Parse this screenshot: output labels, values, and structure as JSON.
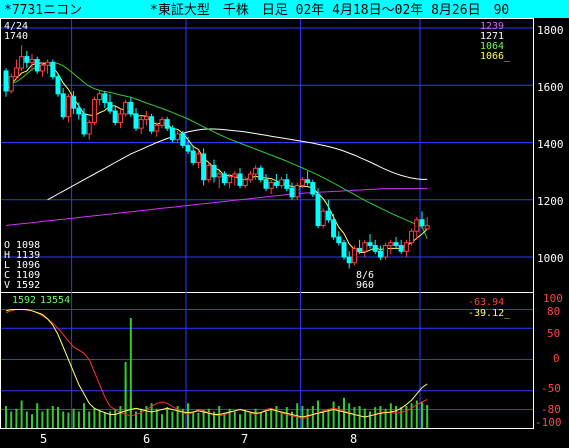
{
  "header": {
    "ticker": "*7731ニコン",
    "index_info": "*東証大型　千株　日足 02年 4月18日〜02年 8月26日　90",
    "colors": {
      "background": "#00ffff",
      "text": "#000000"
    }
  },
  "price_panel": {
    "y_ticks": [
      "1800",
      "1600",
      "1400",
      "1200",
      "1000"
    ],
    "high_annotation": {
      "date": "4/24",
      "value": "1740"
    },
    "low_annotation": {
      "date": "8/6",
      "value": "960"
    },
    "ma_legend": [
      {
        "value": "1239",
        "color": "#cc66ff"
      },
      {
        "value": "1271",
        "color": "#ffffff"
      },
      {
        "value": "1064",
        "color": "#66ff66"
      },
      {
        "value": "1066_",
        "color": "#ffff66"
      }
    ],
    "ohlcv": [
      {
        "label": "O",
        "value": "1098"
      },
      {
        "label": "H",
        "value": "1139"
      },
      {
        "label": "L",
        "value": "1096"
      },
      {
        "label": "C",
        "value": "1109"
      },
      {
        "label": "V",
        "value": "1592"
      }
    ]
  },
  "volume_panel": {
    "volume_labels": [
      "1592",
      "13554"
    ],
    "osc_values": [
      {
        "value": "-63.94",
        "color": "#ff4444"
      },
      {
        "value": "-39.12_",
        "color": "#ffff66"
      }
    ],
    "y_ticks": [
      {
        "label": "100",
        "color": "#ff4444"
      },
      {
        "label": "80",
        "color": "#ff4444"
      },
      {
        "label": "50",
        "color": "#ff4444"
      },
      {
        "label": "0",
        "color": "#ff4444"
      },
      {
        "label": "-50",
        "color": "#ff4444"
      },
      {
        "label": "-80",
        "color": "#ff4444"
      },
      {
        "label": "-100",
        "color": "#ff4444"
      }
    ]
  },
  "x_axis": {
    "month_labels": [
      "5",
      "6",
      "7",
      "8"
    ]
  },
  "chart_data": {
    "type": "line",
    "ylim": [
      900,
      1800
    ],
    "month_starts": [
      13,
      35,
      57,
      80
    ],
    "candles": [
      [
        1650,
        1660,
        1560,
        1580
      ],
      [
        1580,
        1640,
        1570,
        1630
      ],
      [
        1630,
        1690,
        1620,
        1660
      ],
      [
        1660,
        1740,
        1650,
        1700
      ],
      [
        1700,
        1720,
        1660,
        1680
      ],
      [
        1680,
        1710,
        1650,
        1690
      ],
      [
        1690,
        1700,
        1640,
        1650
      ],
      [
        1650,
        1680,
        1630,
        1670
      ],
      [
        1670,
        1690,
        1640,
        1680
      ],
      [
        1680,
        1690,
        1620,
        1630
      ],
      [
        1630,
        1640,
        1560,
        1570
      ],
      [
        1570,
        1590,
        1480,
        1490
      ],
      [
        1490,
        1570,
        1470,
        1560
      ],
      [
        1560,
        1580,
        1500,
        1520
      ],
      [
        1520,
        1540,
        1480,
        1500
      ],
      [
        1500,
        1520,
        1420,
        1430
      ],
      [
        1430,
        1480,
        1410,
        1470
      ],
      [
        1470,
        1560,
        1460,
        1550
      ],
      [
        1550,
        1580,
        1530,
        1570
      ],
      [
        1570,
        1580,
        1520,
        1540
      ],
      [
        1540,
        1570,
        1500,
        1510
      ],
      [
        1510,
        1530,
        1460,
        1470
      ],
      [
        1470,
        1520,
        1450,
        1500
      ],
      [
        1500,
        1550,
        1490,
        1540
      ],
      [
        1540,
        1560,
        1490,
        1500
      ],
      [
        1500,
        1520,
        1440,
        1450
      ],
      [
        1450,
        1490,
        1430,
        1480
      ],
      [
        1480,
        1510,
        1460,
        1490
      ],
      [
        1490,
        1500,
        1430,
        1440
      ],
      [
        1440,
        1470,
        1420,
        1460
      ],
      [
        1460,
        1490,
        1450,
        1480
      ],
      [
        1480,
        1490,
        1440,
        1450
      ],
      [
        1450,
        1460,
        1400,
        1410
      ],
      [
        1410,
        1440,
        1400,
        1430
      ],
      [
        1430,
        1440,
        1380,
        1390
      ],
      [
        1390,
        1420,
        1360,
        1370
      ],
      [
        1370,
        1390,
        1320,
        1330
      ],
      [
        1330,
        1370,
        1310,
        1360
      ],
      [
        1360,
        1380,
        1250,
        1270
      ],
      [
        1270,
        1330,
        1260,
        1320
      ],
      [
        1320,
        1340,
        1260,
        1280
      ],
      [
        1280,
        1300,
        1240,
        1290
      ],
      [
        1290,
        1300,
        1250,
        1260
      ],
      [
        1260,
        1290,
        1240,
        1280
      ],
      [
        1280,
        1300,
        1250,
        1290
      ],
      [
        1290,
        1310,
        1240,
        1250
      ],
      [
        1250,
        1280,
        1240,
        1270
      ],
      [
        1270,
        1300,
        1260,
        1290
      ],
      [
        1290,
        1320,
        1270,
        1310
      ],
      [
        1310,
        1320,
        1260,
        1270
      ],
      [
        1270,
        1290,
        1230,
        1240
      ],
      [
        1240,
        1270,
        1220,
        1260
      ],
      [
        1260,
        1290,
        1240,
        1250
      ],
      [
        1250,
        1280,
        1240,
        1270
      ],
      [
        1270,
        1290,
        1230,
        1240
      ],
      [
        1240,
        1260,
        1200,
        1210
      ],
      [
        1210,
        1260,
        1200,
        1250
      ],
      [
        1250,
        1280,
        1240,
        1270
      ],
      [
        1270,
        1300,
        1250,
        1260
      ],
      [
        1260,
        1270,
        1210,
        1220
      ],
      [
        1220,
        1240,
        1100,
        1110
      ],
      [
        1110,
        1170,
        1100,
        1160
      ],
      [
        1160,
        1200,
        1120,
        1130
      ],
      [
        1130,
        1150,
        1060,
        1070
      ],
      [
        1070,
        1090,
        1040,
        1050
      ],
      [
        1050,
        1060,
        990,
        1000
      ],
      [
        1000,
        1020,
        960,
        980
      ],
      [
        980,
        1040,
        970,
        1030
      ],
      [
        1030,
        1060,
        1010,
        1020
      ],
      [
        1020,
        1060,
        1000,
        1050
      ],
      [
        1050,
        1080,
        1030,
        1040
      ],
      [
        1040,
        1060,
        1010,
        1020
      ],
      [
        1020,
        1040,
        990,
        1000
      ],
      [
        1000,
        1050,
        990,
        1040
      ],
      [
        1040,
        1060,
        1010,
        1050
      ],
      [
        1050,
        1070,
        1030,
        1040
      ],
      [
        1040,
        1060,
        1010,
        1020
      ],
      [
        1020,
        1060,
        1000,
        1050
      ],
      [
        1050,
        1100,
        1040,
        1090
      ],
      [
        1090,
        1140,
        1060,
        1130
      ],
      [
        1130,
        1160,
        1100,
        1110
      ],
      [
        1098,
        1139,
        1096,
        1109
      ]
    ],
    "ma_short": [
      1600,
      1605,
      1612,
      1625,
      1640,
      1655,
      1665,
      1672,
      1678,
      1680,
      1676,
      1668,
      1655,
      1640,
      1625,
      1610,
      1597,
      1588,
      1582,
      1578,
      1575,
      1571,
      1566,
      1562,
      1558,
      1552,
      1545,
      1538,
      1532,
      1525,
      1519,
      1512,
      1505,
      1497,
      1490,
      1482,
      1473,
      1464,
      1455,
      1446,
      1437,
      1428,
      1420,
      1412,
      1405,
      1398,
      1391,
      1384,
      1377,
      1370,
      1363,
      1356,
      1349,
      1342,
      1335,
      1327,
      1319,
      1311,
      1303,
      1295,
      1286,
      1277,
      1268,
      1258,
      1248,
      1238,
      1228,
      1218,
      1208,
      1198,
      1189,
      1180,
      1171,
      1162,
      1153,
      1145,
      1137,
      1129,
      1121,
      1113,
      1106,
      1064
    ],
    "ma_mid": [
      1200,
      1210,
      1220,
      1230,
      1240,
      1250,
      1260,
      1270,
      1280,
      1290,
      1300,
      1310,
      1320,
      1330,
      1340,
      1350,
      1360,
      1368,
      1376,
      1384,
      1392,
      1400,
      1407,
      1414,
      1420,
      1426,
      1432,
      1437,
      1441,
      1444,
      1446,
      1447,
      1447,
      1446,
      1445,
      1443,
      1441,
      1439,
      1437,
      1434,
      1431,
      1428,
      1425,
      1422,
      1419,
      1416,
      1413,
      1410,
      1407,
      1404,
      1401,
      1398,
      1394,
      1390,
      1386,
      1381,
      1376,
      1370,
      1363,
      1356,
      1348,
      1340,
      1332,
      1323,
      1314,
      1306,
      1298,
      1291,
      1285,
      1280,
      1276,
      1273,
      1271,
      1271
    ],
    "ma_long": [
      1110,
      1112,
      1114,
      1116,
      1118,
      1120,
      1122,
      1124,
      1126,
      1128,
      1130,
      1132,
      1134,
      1136,
      1138,
      1140,
      1142,
      1144,
      1146,
      1148,
      1150,
      1152,
      1154,
      1156,
      1158,
      1160,
      1162,
      1164,
      1166,
      1168,
      1170,
      1172,
      1174,
      1176,
      1178,
      1180,
      1182,
      1184,
      1186,
      1188,
      1190,
      1192,
      1194,
      1196,
      1198,
      1200,
      1202,
      1204,
      1206,
      1208,
      1210,
      1212,
      1214,
      1216,
      1218,
      1220,
      1222,
      1223,
      1224,
      1225,
      1226,
      1227,
      1228,
      1229,
      1230,
      1231,
      1232,
      1233,
      1234,
      1235,
      1236,
      1237,
      1238,
      1239,
      1239,
      1239,
      1239,
      1239,
      1239,
      1239,
      1239,
      1239
    ],
    "volume": [
      40,
      30,
      35,
      50,
      30,
      25,
      45,
      30,
      35,
      40,
      38,
      30,
      28,
      35,
      30,
      45,
      30,
      35,
      33,
      28,
      30,
      35,
      40,
      90,
      55,
      30,
      35,
      40,
      45,
      35,
      25,
      38,
      30,
      40,
      35,
      45,
      30,
      28,
      33,
      35,
      30,
      40,
      28,
      35,
      30,
      25,
      33,
      30,
      35,
      28,
      30,
      35,
      40,
      30,
      38,
      30,
      45,
      40,
      35,
      40,
      50,
      30,
      35,
      48,
      40,
      55,
      45,
      38,
      40,
      35,
      30,
      38,
      40,
      35,
      45,
      40,
      38,
      40,
      45,
      50,
      48,
      42
    ],
    "volume_spikes": [
      [
        24,
        200
      ],
      [
        23,
        120
      ]
    ],
    "osc_red": [
      75,
      78,
      80,
      80,
      79,
      78,
      75,
      70,
      65,
      58,
      50,
      40,
      30,
      20,
      15,
      10,
      0,
      -20,
      -40,
      -60,
      -75,
      -80,
      -85,
      -88,
      -90,
      -88,
      -85,
      -80,
      -75,
      -70,
      -68,
      -70,
      -75,
      -80,
      -85,
      -88,
      -85,
      -80,
      -82,
      -85,
      -88,
      -90,
      -88,
      -85,
      -82,
      -80,
      -82,
      -85,
      -88,
      -85,
      -80,
      -78,
      -82,
      -85,
      -88,
      -90,
      -92,
      -95,
      -92,
      -88,
      -85,
      -82,
      -80,
      -78,
      -80,
      -82,
      -85,
      -88,
      -90,
      -92,
      -90,
      -88,
      -85,
      -84,
      -85,
      -86,
      -85,
      -82,
      -78,
      -72,
      -68,
      -64
    ],
    "osc_yellow": [
      78,
      80,
      80,
      80,
      80,
      78,
      75,
      72,
      65,
      55,
      40,
      20,
      0,
      -20,
      -40,
      -55,
      -70,
      -78,
      -82,
      -85,
      -88,
      -88,
      -85,
      -82,
      -80,
      -78,
      -80,
      -82,
      -84,
      -82,
      -80,
      -78,
      -80,
      -82,
      -84,
      -85,
      -84,
      -82,
      -84,
      -86,
      -88,
      -88,
      -86,
      -84,
      -82,
      -80,
      -82,
      -84,
      -86,
      -85,
      -82,
      -80,
      -82,
      -84,
      -86,
      -88,
      -90,
      -92,
      -90,
      -88,
      -86,
      -84,
      -82,
      -80,
      -82,
      -84,
      -86,
      -88,
      -90,
      -92,
      -90,
      -88,
      -86,
      -85,
      -84,
      -82,
      -78,
      -72,
      -65,
      -55,
      -45,
      -39
    ]
  }
}
